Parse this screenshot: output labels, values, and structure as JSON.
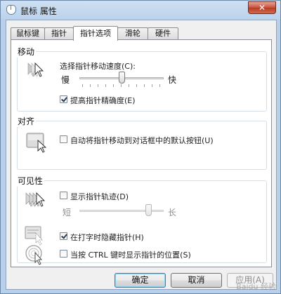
{
  "window": {
    "title": "鼠标 属性",
    "close_glyph": "✕"
  },
  "tabs": [
    {
      "label": "鼠标键"
    },
    {
      "label": "指针"
    },
    {
      "label": "指针选项"
    },
    {
      "label": "滑轮"
    },
    {
      "label": "硬件"
    }
  ],
  "active_tab": 2,
  "motion": {
    "title": "移动",
    "speed_label": "选择指针移动速度(C):",
    "slow_label": "慢",
    "fast_label": "快",
    "speed_level": 0.5,
    "precision_label": "提高指针精确度(E)",
    "precision_checked": true
  },
  "snap": {
    "title": "对齐",
    "label": "自动将指针移动到对话框中的默认按钮(U)",
    "checked": false
  },
  "visibility": {
    "title": "可见性",
    "trails_label": "显示指针轨迹(D)",
    "trails_checked": false,
    "short_label": "短",
    "long_label": "长",
    "trail_level": 0.85,
    "hide_label": "在打字时隐藏指针(H)",
    "hide_checked": true,
    "ctrl_label": "当按 CTRL 键时显示指针的位置(S)",
    "ctrl_checked": false
  },
  "buttons": {
    "ok": "确定",
    "cancel": "取消",
    "apply": "应用(A)"
  },
  "icons": [
    "mouse-icon",
    "cursor-speed-icon",
    "snap-to-button-icon",
    "pointer-trails-icon",
    "hide-pointer-icon",
    "locate-pointer-icon"
  ],
  "colors": {
    "accent": "#3c7fb1",
    "titlebar": "#bcd3ec",
    "close": "#c7503a"
  },
  "watermark": "Baidu 经验"
}
